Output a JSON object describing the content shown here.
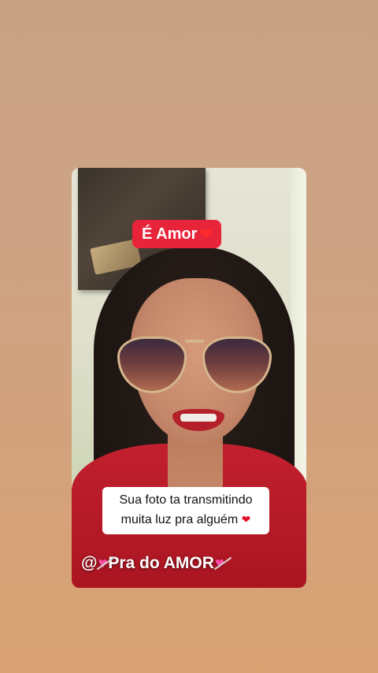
{
  "story": {
    "badge_text": "É Amor",
    "badge_icon": "heart-icon",
    "caption_line1": "Sua foto ta transmitindo",
    "caption_line2": "muita luz pra alguém",
    "caption_icon": "heart-icon",
    "handle_prefix": "@",
    "handle_text": "Pra do AMOR",
    "handle_icon": "heart-with-arrow-icon"
  },
  "colors": {
    "background": "#cda385",
    "badge": "#e8243b",
    "caption_bg": "#ffffff",
    "heart": "#e1132a",
    "heart_arrow": "#ff4da6"
  }
}
